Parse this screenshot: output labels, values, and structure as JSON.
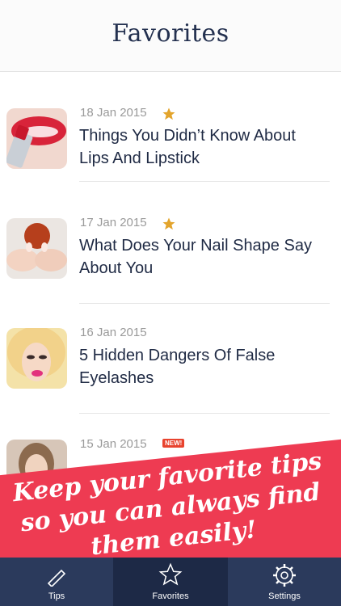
{
  "header": {
    "title": "Favorites"
  },
  "items": [
    {
      "date": "18 Jan 2015",
      "starred": true,
      "title": "Things You Didn’t Know About Lips And Lipstick",
      "thumb_icon": "lipstick-photo"
    },
    {
      "date": "17 Jan 2015",
      "starred": true,
      "title": "What Does Your Nail Shape Say About You",
      "thumb_icon": "nails-photo"
    },
    {
      "date": "16 Jan 2015",
      "starred": false,
      "title": "5 Hidden Dangers Of False Eyelashes",
      "thumb_icon": "eyelashes-photo"
    },
    {
      "date": "15 Jan 2015",
      "badge": "NEW!",
      "thumb_icon": "portrait-photo"
    }
  ],
  "banner": {
    "line1": "Keep your favorite tips",
    "line2": "so you can always find",
    "line3": "them easily!"
  },
  "tabs": [
    {
      "label": "Tips",
      "icon": "pen-icon"
    },
    {
      "label": "Favorites",
      "icon": "star-icon",
      "active": true
    },
    {
      "label": "Settings",
      "icon": "gear-icon"
    }
  ],
  "colors": {
    "accent": "#ee3b52",
    "star": "#e3a42c",
    "tabbar": "#2b3a5c",
    "badge": "#e8432e"
  }
}
